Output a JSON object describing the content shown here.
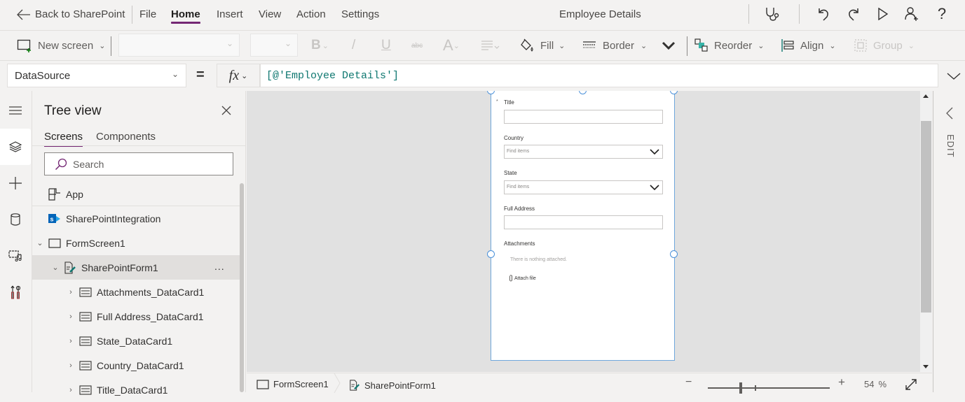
{
  "menubar": {
    "back_label": "Back to SharePoint",
    "items": [
      "File",
      "Home",
      "Insert",
      "View",
      "Action",
      "Settings"
    ],
    "active_item": "Home",
    "app_title": "Employee Details",
    "right_icons": [
      "stethoscope-icon",
      "undo-icon",
      "redo-icon",
      "play-icon",
      "share-user-icon",
      "help-icon"
    ],
    "accent_color": "#742774"
  },
  "toolbar": {
    "new_screen_label": "New screen",
    "font_family_value": "",
    "font_size_value": "",
    "bold_label": "B",
    "italic_label": "/",
    "underline_label": "U",
    "strike_label": "abc",
    "font_color_label": "A",
    "fill_label": "Fill",
    "border_label": "Border",
    "reorder_label": "Reorder",
    "align_label": "Align",
    "group_label": "Group"
  },
  "formulabar": {
    "property": "DataSource",
    "equals": "=",
    "fx_label": "fx",
    "formula": "[@'Employee Details']"
  },
  "rail": {
    "items": [
      "hamburger-icon",
      "layers-icon",
      "plus-icon",
      "database-icon",
      "media-icon",
      "tools-icon"
    ],
    "active": "layers-icon"
  },
  "tree": {
    "title": "Tree view",
    "tabs": [
      "Screens",
      "Components"
    ],
    "active_tab": "Screens",
    "search_placeholder": "Search",
    "items": [
      {
        "label": "App",
        "level": 0,
        "icon": "app-icon",
        "expandable": false
      },
      {
        "label": "SharePointIntegration",
        "level": 0,
        "icon": "sharepoint-icon",
        "expandable": false
      },
      {
        "label": "FormScreen1",
        "level": 0,
        "icon": "screen-icon",
        "expandable": true,
        "expanded": true
      },
      {
        "label": "SharePointForm1",
        "level": 1,
        "icon": "form-icon",
        "expandable": true,
        "expanded": true,
        "selected": true
      },
      {
        "label": "Attachments_DataCard1",
        "level": 2,
        "icon": "datacard-icon",
        "expandable": true
      },
      {
        "label": "Full Address_DataCard1",
        "level": 2,
        "icon": "datacard-icon",
        "expandable": true
      },
      {
        "label": "State_DataCard1",
        "level": 2,
        "icon": "datacard-icon",
        "expandable": true
      },
      {
        "label": "Country_DataCard1",
        "level": 2,
        "icon": "datacard-icon",
        "expandable": true
      },
      {
        "label": "Title_DataCard1",
        "level": 2,
        "icon": "datacard-icon",
        "expandable": true
      }
    ],
    "more_label": "..."
  },
  "form": {
    "required_marker": "*",
    "fields": [
      {
        "label": "Title",
        "type": "text",
        "value": ""
      },
      {
        "label": "Country",
        "type": "dropdown",
        "placeholder": "Find items"
      },
      {
        "label": "State",
        "type": "dropdown",
        "placeholder": "Find items"
      },
      {
        "label": "Full Address",
        "type": "text",
        "value": ""
      }
    ],
    "attachments_label": "Attachments",
    "attachments_empty": "There is nothing attached.",
    "attach_file_label": "Attach file"
  },
  "rightpanel": {
    "edit_label": "EDIT"
  },
  "statusbar": {
    "breadcrumb": [
      "FormScreen1",
      "SharePointForm1"
    ],
    "zoom_minus": "−",
    "zoom_plus": "+",
    "zoom_value": "54",
    "zoom_unit": "%",
    "zoom_fraction": 0.27
  }
}
